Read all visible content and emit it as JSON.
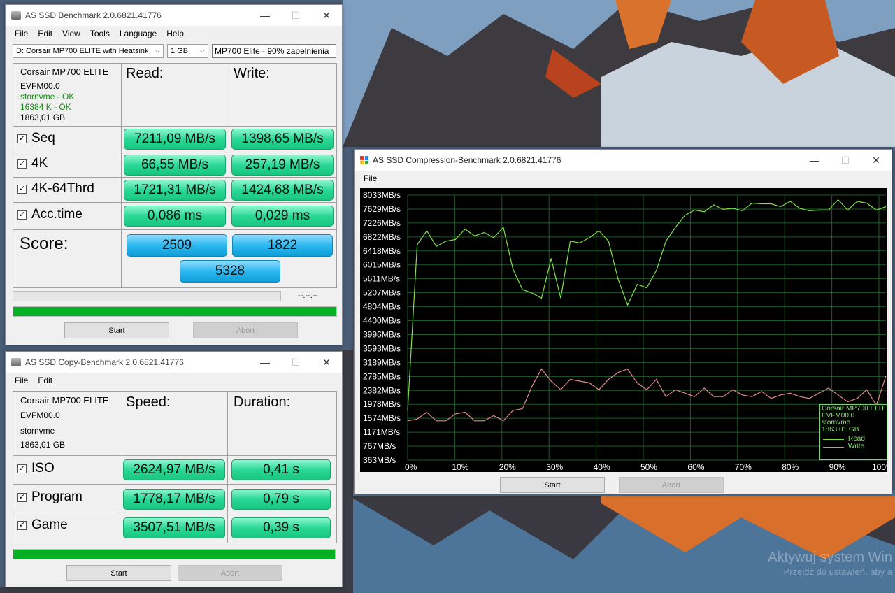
{
  "main_window": {
    "title": "AS SSD Benchmark 2.0.6821.41776",
    "menu": [
      "File",
      "Edit",
      "View",
      "Tools",
      "Language",
      "Help"
    ],
    "drive_select": "D: Corsair MP700 ELITE with Heatsink",
    "size_select": "1 GB",
    "label_field": "MP700 Elite - 90% zapelnienia",
    "drive_info": {
      "model": "Corsair MP700 ELITE",
      "firmware": "EVFM00.0",
      "driver": "stornvme - OK",
      "align": "16384 K - OK",
      "capacity": "1863,01 GB"
    },
    "read_header": "Read:",
    "write_header": "Write:",
    "rows": [
      {
        "label": "Seq",
        "read": "7211,09 MB/s",
        "write": "1398,65 MB/s"
      },
      {
        "label": "4K",
        "read": "66,55 MB/s",
        "write": "257,19 MB/s"
      },
      {
        "label": "4K-64Thrd",
        "read": "1721,31 MB/s",
        "write": "1424,68 MB/s"
      },
      {
        "label": "Acc.time",
        "read": "0,086 ms",
        "write": "0,029 ms"
      }
    ],
    "score_label": "Score:",
    "score_read": "2509",
    "score_write": "1822",
    "score_total": "5328",
    "time_readout": "--:--:--",
    "start_label": "Start",
    "abort_label": "Abort"
  },
  "copy_window": {
    "title": "AS SSD Copy-Benchmark 2.0.6821.41776",
    "menu": [
      "File",
      "Edit"
    ],
    "drive_info": {
      "model": "Corsair MP700 ELITE",
      "firmware": "EVFM00.0",
      "driver": "stornvme",
      "capacity": "1863,01 GB"
    },
    "speed_header": "Speed:",
    "duration_header": "Duration:",
    "rows": [
      {
        "label": "ISO",
        "speed": "2624,97 MB/s",
        "duration": "0,41 s"
      },
      {
        "label": "Program",
        "speed": "1778,17 MB/s",
        "duration": "0,79 s"
      },
      {
        "label": "Game",
        "speed": "3507,51 MB/s",
        "duration": "0,39 s"
      }
    ],
    "start_label": "Start",
    "abort_label": "Abort"
  },
  "compression_window": {
    "title": "AS SSD Compression-Benchmark 2.0.6821.41776",
    "menu": [
      "File"
    ],
    "start_label": "Start",
    "abort_label": "Abort",
    "legend": {
      "model": "Corsair MP700 ELITE",
      "firmware": "EVFM00.0",
      "driver": "stornvme",
      "capacity": "1863,01 GB",
      "read": "Read",
      "write": "Write"
    },
    "colors": {
      "read": "#7ee04a",
      "write": "#e08a8a"
    }
  },
  "chart_data": {
    "type": "line",
    "y_tick_labels": [
      "8033MB/s",
      "7629MB/s",
      "7226MB/s",
      "6822MB/s",
      "6418MB/s",
      "6015MB/s",
      "5611MB/s",
      "5207MB/s",
      "4804MB/s",
      "4400MB/s",
      "3996MB/s",
      "3593MB/s",
      "3189MB/s",
      "2785MB/s",
      "2382MB/s",
      "1978MB/s",
      "1574MB/s",
      "1171MB/s",
      "767MB/s",
      "363MB/s"
    ],
    "x_tick_labels": [
      "0%",
      "10%",
      "20%",
      "30%",
      "40%",
      "50%",
      "60%",
      "70%",
      "80%",
      "90%",
      "100%"
    ],
    "ylim": [
      363,
      8033
    ],
    "xlim": [
      0,
      100
    ],
    "series": [
      {
        "name": "Read",
        "x": [
          0,
          2,
          4,
          6,
          8,
          10,
          12,
          14,
          16,
          18,
          20,
          22,
          24,
          26,
          28,
          30,
          32,
          34,
          36,
          38,
          40,
          42,
          44,
          46,
          48,
          50,
          52,
          54,
          56,
          58,
          60,
          62,
          64,
          66,
          68,
          70,
          72,
          74,
          76,
          78,
          80,
          82,
          84,
          86,
          88,
          90,
          92,
          94,
          96,
          98,
          100
        ],
        "values": [
          1800,
          6600,
          7000,
          6550,
          6700,
          6750,
          7050,
          6850,
          6950,
          6800,
          7100,
          5900,
          5300,
          5200,
          5050,
          6200,
          5050,
          6700,
          6650,
          6800,
          7000,
          6700,
          5600,
          4850,
          5450,
          5350,
          5850,
          6700,
          7100,
          7450,
          7600,
          7550,
          7750,
          7620,
          7650,
          7580,
          7800,
          7780,
          7780,
          7700,
          7850,
          7650,
          7580,
          7600,
          7600,
          7900,
          7600,
          7850,
          7800,
          7600,
          7700
        ]
      },
      {
        "name": "Write",
        "x": [
          0,
          2,
          4,
          6,
          8,
          10,
          12,
          14,
          16,
          18,
          20,
          22,
          24,
          26,
          28,
          30,
          32,
          34,
          36,
          38,
          40,
          42,
          44,
          46,
          48,
          50,
          52,
          54,
          56,
          58,
          60,
          62,
          64,
          66,
          68,
          70,
          72,
          74,
          76,
          78,
          80,
          82,
          84,
          86,
          88,
          90,
          92,
          94,
          96,
          98,
          100
        ],
        "values": [
          1500,
          1550,
          1750,
          1500,
          1500,
          1700,
          1750,
          1500,
          1500,
          1650,
          1500,
          1800,
          1850,
          2500,
          3000,
          2650,
          2400,
          2700,
          2650,
          2600,
          2400,
          2700,
          2900,
          3000,
          2600,
          2400,
          2700,
          2200,
          2400,
          2300,
          2200,
          2450,
          2200,
          2200,
          2400,
          2250,
          2200,
          2350,
          2150,
          2250,
          2300,
          2200,
          2150,
          2300,
          2450,
          2250,
          2050,
          2150,
          2400,
          1950,
          2800
        ]
      }
    ]
  }
}
